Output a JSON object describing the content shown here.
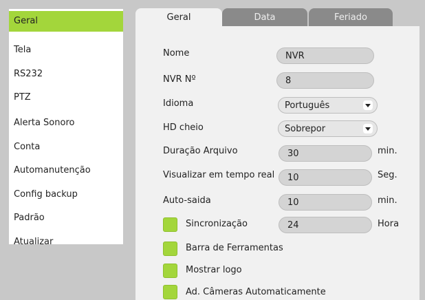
{
  "sidebar": {
    "items": [
      {
        "label": "Geral"
      },
      {
        "label": "Tela"
      },
      {
        "label": "RS232"
      },
      {
        "label": "PTZ"
      },
      {
        "label": "Alerta Sonoro"
      },
      {
        "label": "Conta"
      },
      {
        "label": "Automanutenção"
      },
      {
        "label": "Config backup"
      },
      {
        "label": "Padrão"
      },
      {
        "label": "Atualizar"
      }
    ],
    "active": "Geral"
  },
  "tabs": [
    {
      "label": "Geral",
      "active": true
    },
    {
      "label": "Data",
      "active": false
    },
    {
      "label": "Feriado",
      "active": false
    }
  ],
  "form": {
    "nome": {
      "label": "Nome",
      "value": "NVR"
    },
    "nvr_no": {
      "label": "NVR Nº",
      "value": "8"
    },
    "idioma": {
      "label": "Idioma",
      "value": "Português"
    },
    "hd_cheio": {
      "label": "HD cheio",
      "value": "Sobrepor"
    },
    "duracao": {
      "label": "Duração Arquivo",
      "value": "30",
      "unit": "min."
    },
    "visualizar": {
      "label": "Visualizar em tempo real",
      "value": "10",
      "unit": "Seg."
    },
    "auto_saida": {
      "label": "Auto-saida",
      "value": "10",
      "unit": "min."
    },
    "sincronizacao": {
      "label": "Sincronização",
      "value": "24",
      "unit": "Hora"
    },
    "barra": {
      "label": "Barra de Ferramentas"
    },
    "mostrar_logo": {
      "label": "Mostrar logo"
    },
    "ad_cameras": {
      "label": "Ad. Câmeras Automaticamente"
    }
  },
  "colors": {
    "accent": "#a3d63b",
    "background": "#c8c8c8",
    "panel": "#f1f1f1",
    "tab_inactive": "#8a8a8a"
  }
}
